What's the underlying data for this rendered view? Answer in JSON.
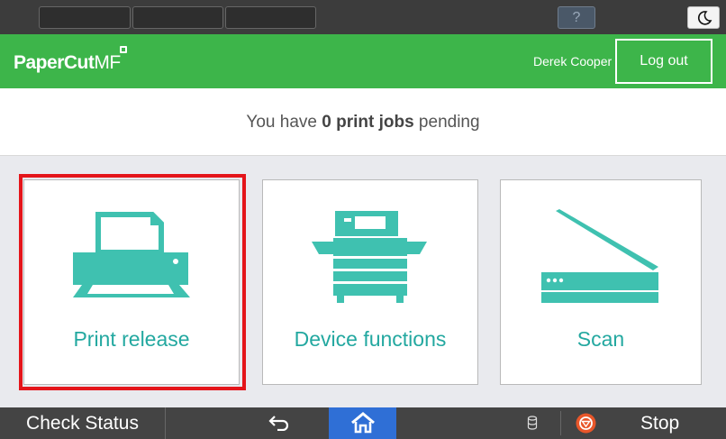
{
  "system_bar": {
    "help_label": "?"
  },
  "header": {
    "brand_main": "PaperCut",
    "brand_suffix": "MF",
    "user_name": "Derek Cooper",
    "logout_label": "Log out"
  },
  "status": {
    "prefix": "You have ",
    "count_text": "0 print jobs",
    "suffix": " pending"
  },
  "tiles": [
    {
      "label": "Print release",
      "icon": "printer-icon",
      "highlighted": true
    },
    {
      "label": "Device functions",
      "icon": "copier-icon",
      "highlighted": false
    },
    {
      "label": "Scan",
      "icon": "scanner-icon",
      "highlighted": false
    }
  ],
  "bottom_bar": {
    "check_status_label": "Check Status",
    "stop_label": "Stop"
  },
  "colors": {
    "brand_green": "#3db54a",
    "accent_teal": "#3fc1b0",
    "highlight_red": "#e4151a",
    "home_blue": "#2f6fd6",
    "stop_orange": "#e8562a"
  }
}
